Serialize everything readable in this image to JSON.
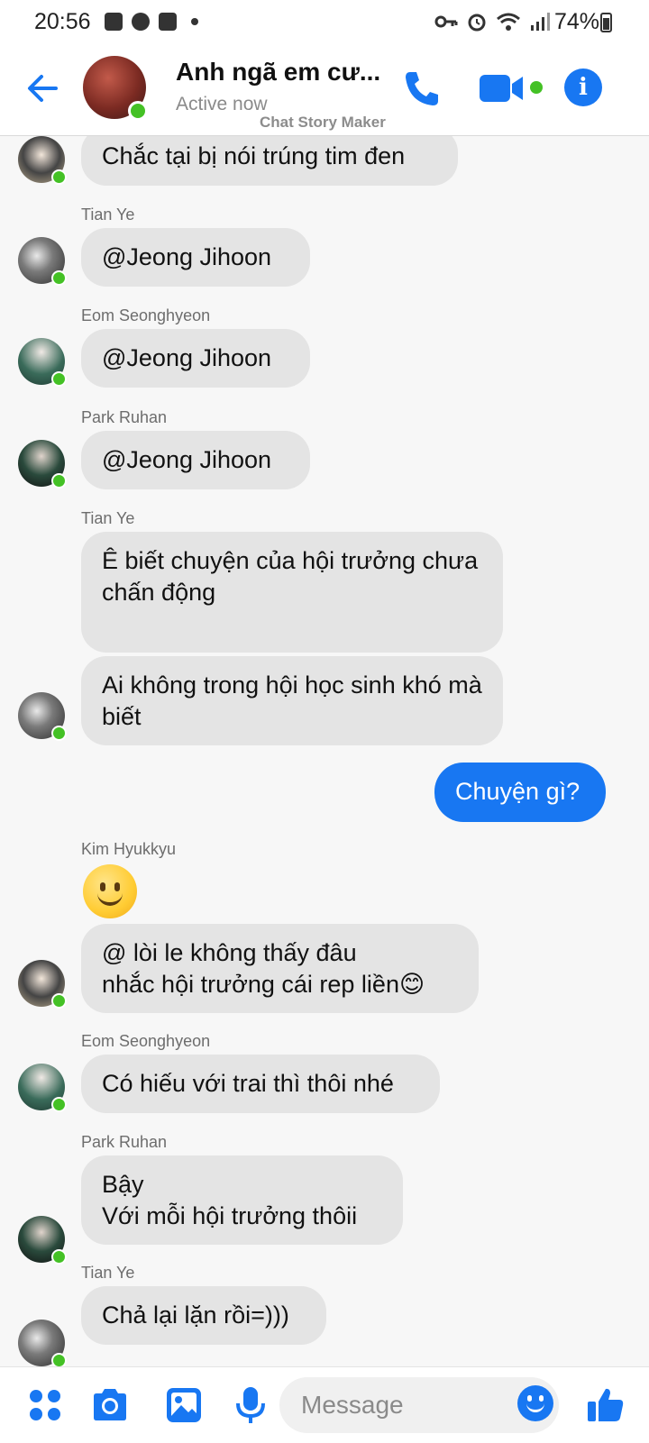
{
  "status_bar": {
    "time": "20:56",
    "battery": "74%"
  },
  "header": {
    "title": "Anh ngã em cư...",
    "status": "Active now",
    "watermark": "Chat Story Maker",
    "back_icon": "arrow-left-icon",
    "call_icon": "phone-icon",
    "video_icon": "video-camera-icon",
    "info_icon": "info-icon",
    "info_glyph": "i"
  },
  "messages": [
    {
      "sender": "",
      "text": "Chắc tại bị nói trúng tim đen",
      "mine": false
    },
    {
      "sender": "Tian Ye",
      "text": "@Jeong Jihoon",
      "mine": false
    },
    {
      "sender": "Eom Seonghyeon",
      "text": "@Jeong Jihoon",
      "mine": false
    },
    {
      "sender": "Park Ruhan",
      "text": "@Jeong Jihoon",
      "mine": false
    },
    {
      "sender": "Tian Ye",
      "text": "Ê biết chuyện của hội trưởng chưa\nchấn động",
      "mine": false
    },
    {
      "sender": "",
      "text": "Ai không trong hội học sinh khó mà biết",
      "mine": false
    },
    {
      "sender": "",
      "text": "Chuyện gì?",
      "mine": true
    },
    {
      "sender": "Kim Hyukkyu",
      "text": "",
      "emoji": "slightly-smiling-face",
      "mine": false
    },
    {
      "sender": "",
      "text": "@ lòi le không thấy đâu\nnhắc hội trưởng cái rep liền😊",
      "mine": false
    },
    {
      "sender": "Eom Seonghyeon",
      "text": "Có hiếu với trai thì thôi nhé",
      "mine": false
    },
    {
      "sender": "Park Ruhan",
      "text": "Bậy\nVới mỗi hội trưởng thôii",
      "mine": false
    },
    {
      "sender": "Tian Ye",
      "text": "Chả lại lặn rồi=)))",
      "mine": false
    }
  ],
  "composer": {
    "placeholder": "Message",
    "icons": [
      "menu-dots-icon",
      "camera-icon",
      "image-icon",
      "microphone-icon",
      "emoji-icon",
      "thumbs-up-icon"
    ]
  },
  "colors": {
    "accent": "#1877f2",
    "online": "#44c125",
    "bubble_other": "#e4e4e4"
  }
}
